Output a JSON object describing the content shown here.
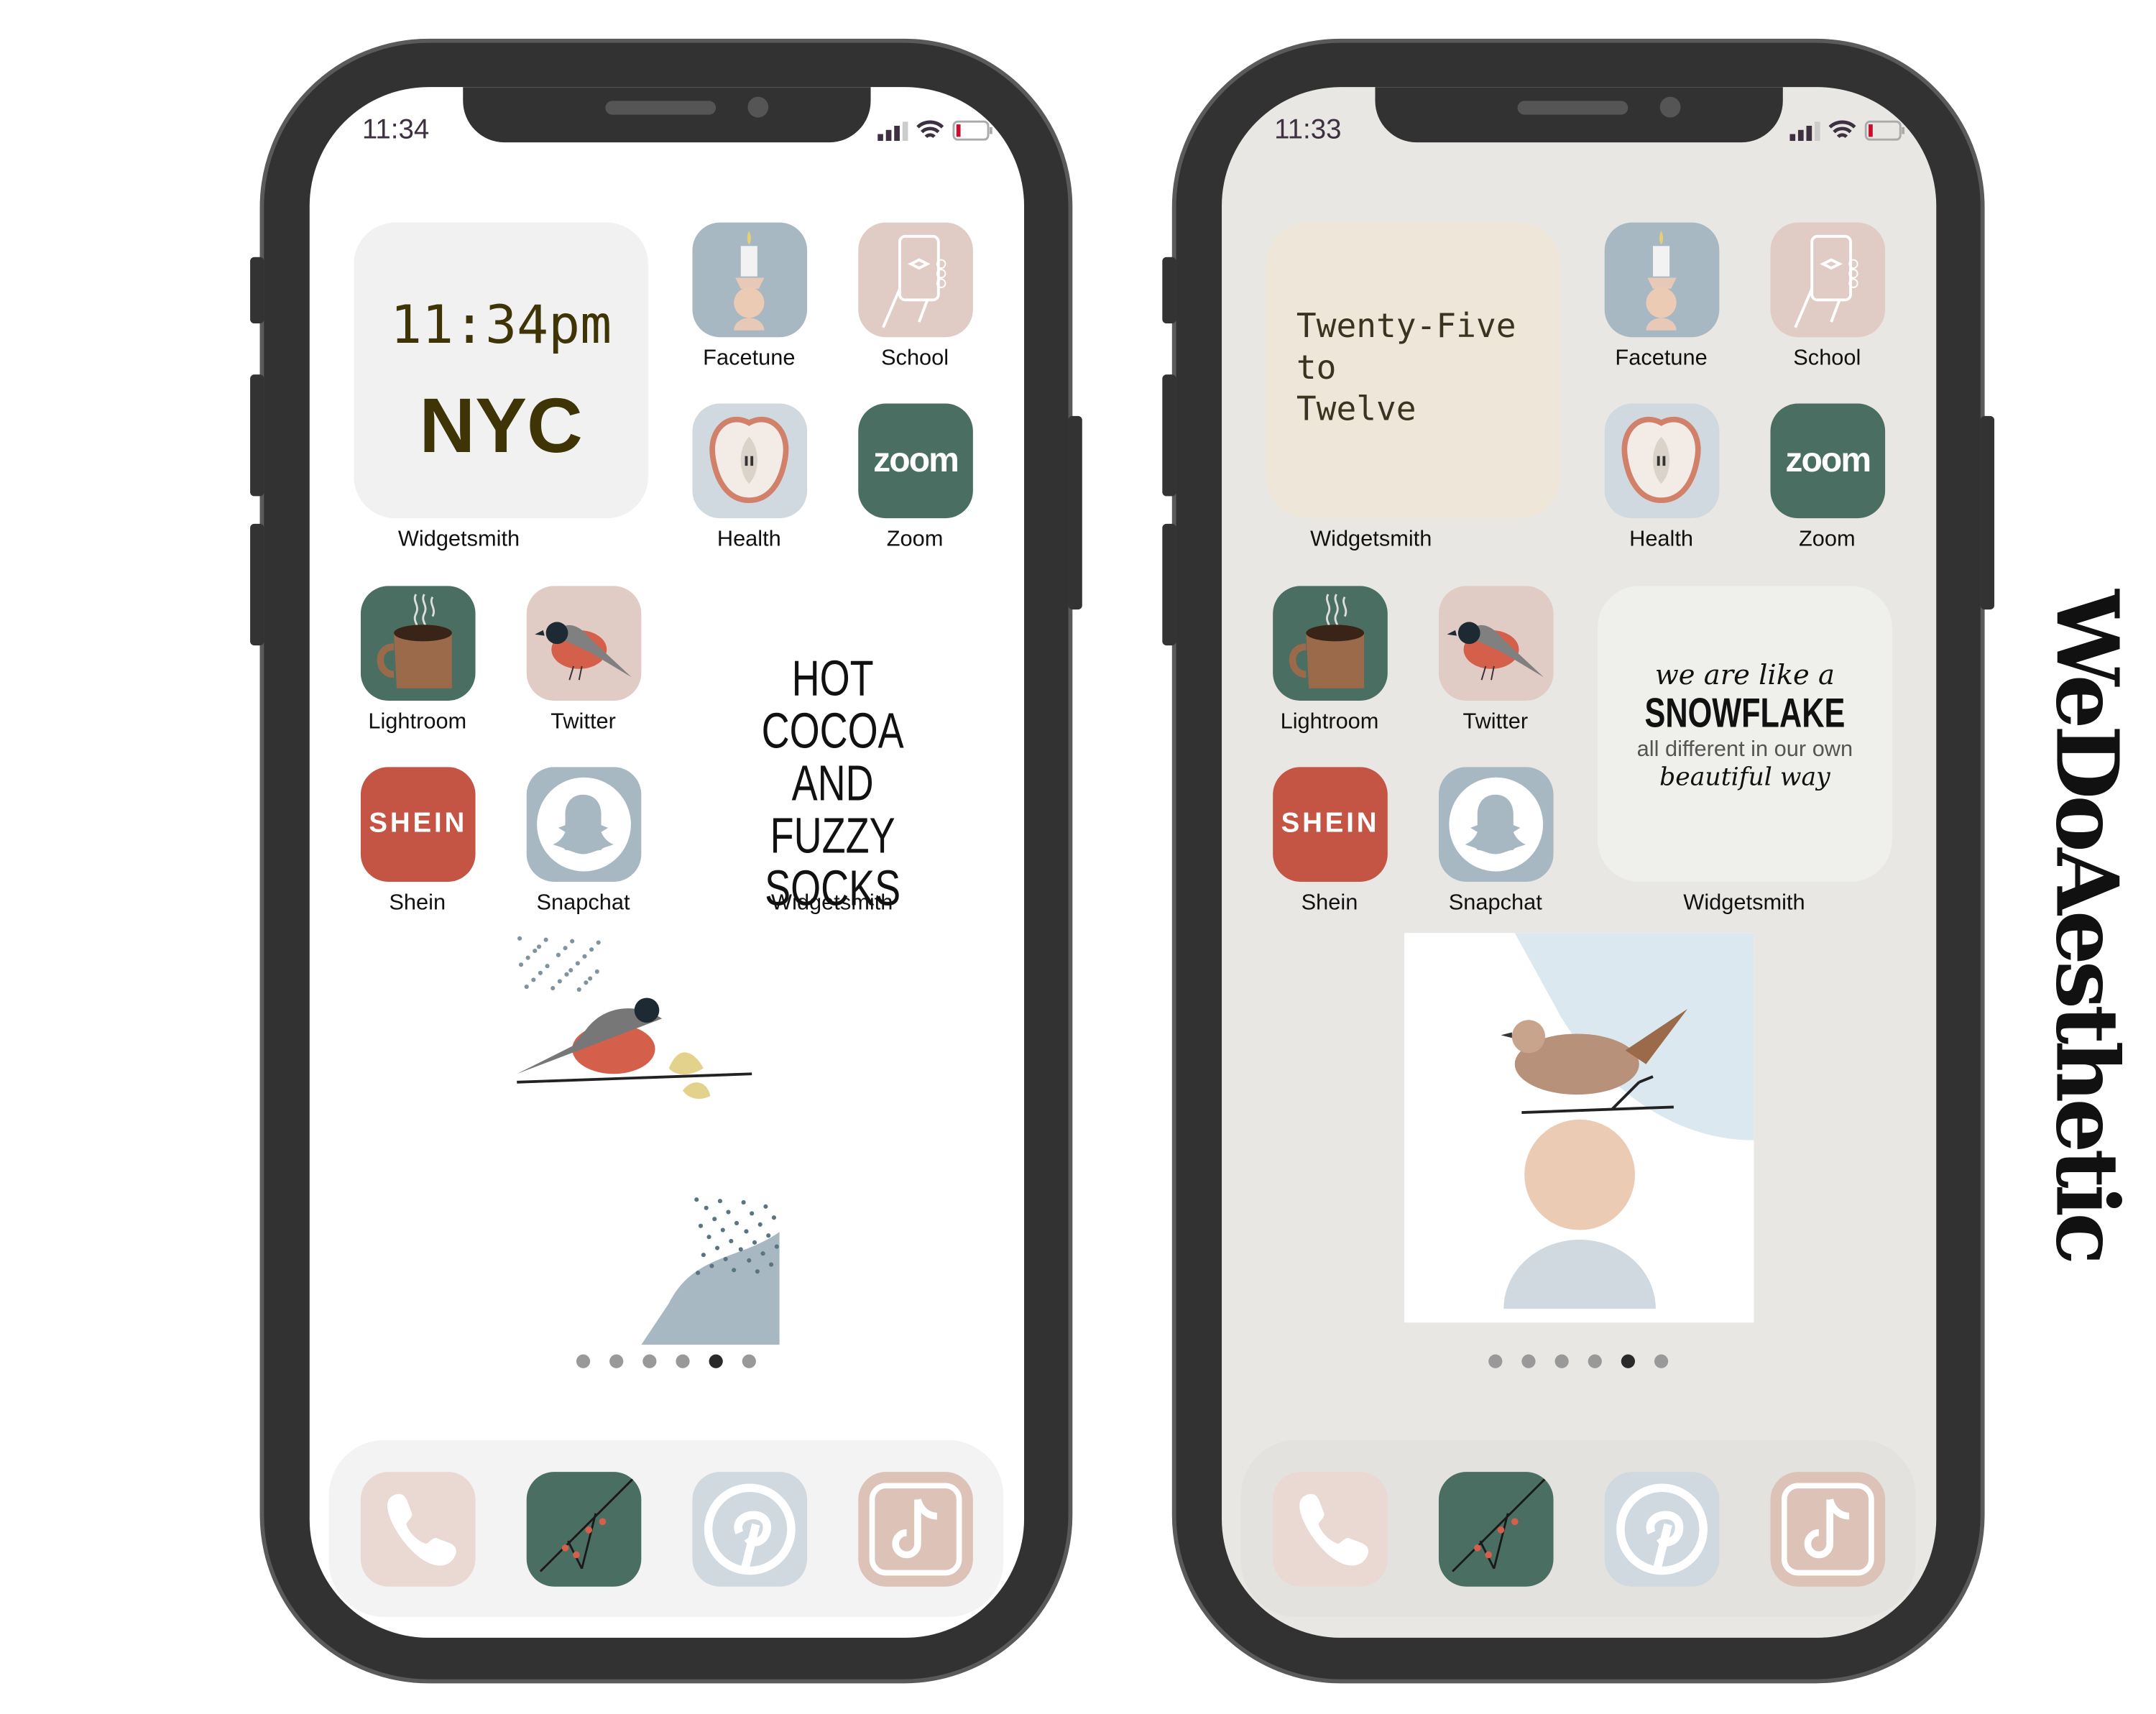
{
  "brand": "WeDoAesthetic",
  "phones": [
    {
      "status_time": "11:34",
      "wallpaper": "#ffffff",
      "widget1": {
        "line1": "11:34pm",
        "line2": "NYC",
        "label": "Widgetsmith"
      },
      "apps": [
        "Facetune",
        "School",
        "Health",
        "Zoom",
        "Lightroom",
        "Twitter",
        "Shein",
        "Snapchat"
      ],
      "widget2": {
        "lines": [
          "HOT COCOA",
          "AND",
          "FUZZY SOCKS"
        ],
        "label": "Widgetsmith"
      },
      "page_count": 6,
      "active_page": 5
    },
    {
      "status_time": "11:33",
      "wallpaper": "#e9e7e3",
      "widget1": {
        "lines": [
          "Twenty-Five",
          "to",
          "Twelve"
        ],
        "label": "Widgetsmith"
      },
      "apps": [
        "Facetune",
        "School",
        "Health",
        "Zoom",
        "Lightroom",
        "Twitter",
        "Shein",
        "Snapchat"
      ],
      "widget2": {
        "script1": "we are like a",
        "headline": "SNOWFLAKE",
        "body": "all different in our own",
        "script2": "beautiful way",
        "label": "Widgetsmith"
      },
      "page_count": 6,
      "active_page": 5
    }
  ],
  "icon_text": {
    "zoom": "zoom",
    "shein": "SHEIN"
  },
  "dock": [
    "phone-icon",
    "photos-icon",
    "pinterest-icon",
    "tiktok-icon"
  ],
  "colors": {
    "blue": "#a7b8c3",
    "pink": "#e0ccc5",
    "green": "#4a6e62",
    "red": "#c45444",
    "frame": "#323232"
  }
}
